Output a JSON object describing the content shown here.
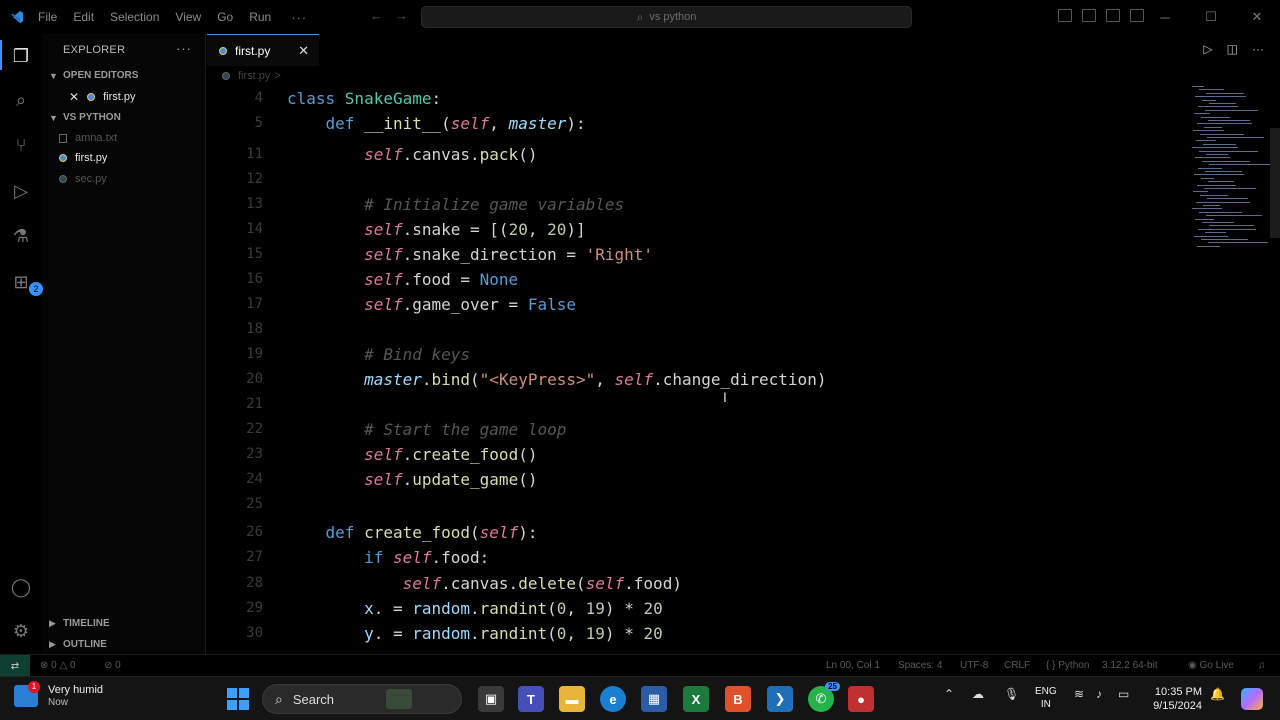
{
  "titlebar": {
    "menu": [
      "File",
      "Edit",
      "Selection",
      "View",
      "Go",
      "Run"
    ],
    "more": "···",
    "search_text": "vs python"
  },
  "sidebar": {
    "header": "EXPLORER",
    "more": "···",
    "open_editors_label": "OPEN EDITORS",
    "open_editors": [
      "first.py"
    ],
    "folder_label": "VS PYTHON",
    "files": [
      "amna.txt",
      "first.py",
      "sec.py"
    ],
    "timeline_label": "TIMELINE",
    "outline_label": "OUTLINE",
    "badge_count": "2"
  },
  "editor": {
    "tab_label": "first.py",
    "breadcrumb_file": "first.py",
    "breadcrumb_sep": ">",
    "lines": [
      {
        "n": "4",
        "tokens": [
          [
            "kw",
            "class "
          ],
          [
            "cls",
            "SnakeGame"
          ],
          [
            "",
            ":"
          ]
        ]
      },
      {
        "n": "5",
        "tokens": [
          [
            "",
            "    "
          ],
          [
            "kw",
            "def "
          ],
          [
            "fn",
            "__init__"
          ],
          [
            "",
            "("
          ],
          [
            "slf",
            "self"
          ],
          [
            "",
            ", "
          ],
          [
            "prm",
            "master"
          ],
          [
            "",
            "):"
          ]
        ]
      },
      {
        "n": "11",
        "tokens": [
          [
            "",
            "        "
          ],
          [
            "slf",
            "self"
          ],
          [
            "",
            ".canvas."
          ],
          [
            "fn",
            "pack"
          ],
          [
            "",
            "()"
          ]
        ]
      },
      {
        "n": "12",
        "tokens": []
      },
      {
        "n": "13",
        "tokens": [
          [
            "",
            "        "
          ],
          [
            "cmt",
            "# Initialize game variables"
          ]
        ]
      },
      {
        "n": "14",
        "tokens": [
          [
            "",
            "        "
          ],
          [
            "slf",
            "self"
          ],
          [
            "",
            ".snake = [("
          ],
          [
            "num",
            "20"
          ],
          [
            "",
            ", "
          ],
          [
            "num",
            "20"
          ],
          [
            "",
            ")]"
          ]
        ]
      },
      {
        "n": "15",
        "tokens": [
          [
            "",
            "        "
          ],
          [
            "slf",
            "self"
          ],
          [
            "",
            ".snake_direction = "
          ],
          [
            "str",
            "'Right'"
          ]
        ]
      },
      {
        "n": "16",
        "tokens": [
          [
            "",
            "        "
          ],
          [
            "slf",
            "self"
          ],
          [
            "",
            ".food = "
          ],
          [
            "cons",
            "None"
          ]
        ]
      },
      {
        "n": "17",
        "tokens": [
          [
            "",
            "        "
          ],
          [
            "slf",
            "self"
          ],
          [
            "",
            ".game_over = "
          ],
          [
            "cons",
            "False"
          ]
        ]
      },
      {
        "n": "18",
        "tokens": []
      },
      {
        "n": "19",
        "tokens": [
          [
            "",
            "        "
          ],
          [
            "cmt",
            "# Bind keys"
          ]
        ]
      },
      {
        "n": "20",
        "tokens": [
          [
            "",
            "        "
          ],
          [
            "prm",
            "master"
          ],
          [
            "",
            "."
          ],
          [
            "fn",
            "bind"
          ],
          [
            "",
            "("
          ],
          [
            "str",
            "\"<KeyPress>\""
          ],
          [
            "",
            ", "
          ],
          [
            "slf",
            "self"
          ],
          [
            "",
            ".change_direction)"
          ]
        ]
      },
      {
        "n": "21",
        "tokens": []
      },
      {
        "n": "22",
        "tokens": [
          [
            "",
            "        "
          ],
          [
            "cmt",
            "# Start the game loop"
          ]
        ]
      },
      {
        "n": "23",
        "tokens": [
          [
            "",
            "        "
          ],
          [
            "slf",
            "self"
          ],
          [
            "",
            "."
          ],
          [
            "fn",
            "create_food"
          ],
          [
            "",
            "()"
          ]
        ]
      },
      {
        "n": "24",
        "tokens": [
          [
            "",
            "        "
          ],
          [
            "slf",
            "self"
          ],
          [
            "",
            "."
          ],
          [
            "fn",
            "update_game"
          ],
          [
            "",
            "()"
          ]
        ]
      },
      {
        "n": "25",
        "tokens": []
      },
      {
        "n": "26",
        "tokens": [
          [
            "",
            "    "
          ],
          [
            "kw",
            "def "
          ],
          [
            "fn",
            "create_food"
          ],
          [
            "",
            "("
          ],
          [
            "slf",
            "self"
          ],
          [
            "",
            "):"
          ]
        ]
      },
      {
        "n": "27",
        "tokens": [
          [
            "",
            "        "
          ],
          [
            "kw",
            "if "
          ],
          [
            "slf",
            "self"
          ],
          [
            "",
            ".food:"
          ]
        ]
      },
      {
        "n": "28",
        "tokens": [
          [
            "",
            "            "
          ],
          [
            "slf",
            "self"
          ],
          [
            "",
            ".canvas."
          ],
          [
            "fn",
            "delete"
          ],
          [
            "",
            "("
          ],
          [
            "slf",
            "self"
          ],
          [
            "",
            ".food)"
          ]
        ]
      },
      {
        "n": "29",
        "tokens": [
          [
            "",
            "        "
          ],
          [
            "blue",
            "x"
          ],
          [
            "",
            ". = "
          ],
          [
            "blue",
            "random"
          ],
          [
            "",
            "."
          ],
          [
            "fn",
            "randint"
          ],
          [
            "",
            "("
          ],
          [
            "num",
            "0"
          ],
          [
            "",
            ", "
          ],
          [
            "num",
            "19"
          ],
          [
            "",
            ") * "
          ],
          [
            "num",
            "20"
          ]
        ]
      },
      {
        "n": "30",
        "tokens": [
          [
            "",
            "        "
          ],
          [
            "blue",
            "y"
          ],
          [
            "",
            ". = "
          ],
          [
            "blue",
            "random"
          ],
          [
            "",
            "."
          ],
          [
            "fn",
            "randint"
          ],
          [
            "",
            "("
          ],
          [
            "num",
            "0"
          ],
          [
            "",
            ", "
          ],
          [
            "num",
            "19"
          ],
          [
            "",
            ") * "
          ],
          [
            "num",
            "20"
          ]
        ]
      }
    ]
  },
  "statusbar": {
    "errors": "0",
    "warnings": "0",
    "ports": "0",
    "position": "Ln 00, Col 1",
    "spaces": "Spaces: 4",
    "encoding": "UTF-8",
    "eol": "CRLF",
    "language": "Python",
    "interpreter": "3.12.2 64-bit",
    "golive": "Go Live"
  },
  "taskbar": {
    "weather_title": "Very humid",
    "weather_sub": "Now",
    "weather_badge": "1",
    "search_label": "Search",
    "whatsapp_badge": "25",
    "lang_top": "ENG",
    "lang_bottom": "IN",
    "time": "10:35 PM",
    "date": "9/15/2024"
  }
}
